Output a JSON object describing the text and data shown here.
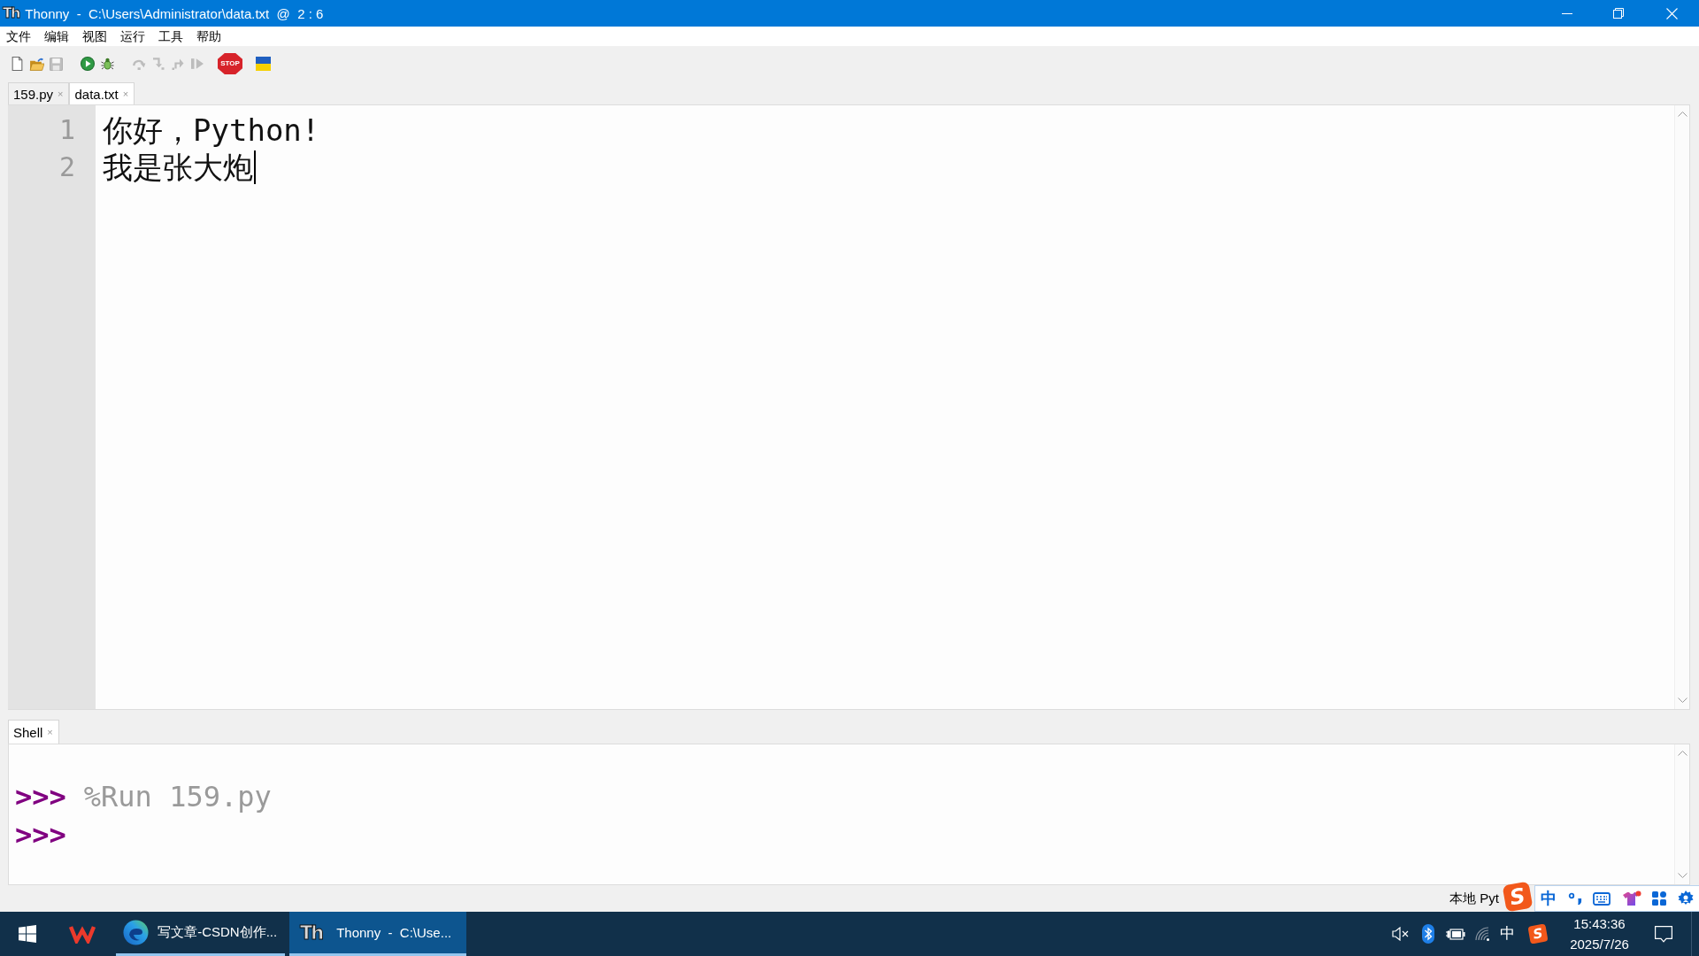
{
  "window": {
    "logo": "Th",
    "title": "Thonny  -  C:\\Users\\Administrator\\data.txt  @  2 : 6"
  },
  "menu": [
    "文件",
    "编辑",
    "视图",
    "运行",
    "工具",
    "帮助"
  ],
  "toolbar": [
    [
      {
        "kind": "new",
        "disabled": false
      },
      {
        "kind": "open",
        "disabled": false
      },
      {
        "kind": "save",
        "disabled": true
      }
    ],
    [
      {
        "kind": "run",
        "disabled": false
      },
      {
        "kind": "debug",
        "disabled": false
      }
    ],
    [
      {
        "kind": "step_over",
        "disabled": true
      },
      {
        "kind": "step_into",
        "disabled": true
      },
      {
        "kind": "step_out",
        "disabled": true
      },
      {
        "kind": "resume",
        "disabled": true
      }
    ],
    [
      {
        "kind": "stop",
        "label": "STOP",
        "disabled": false
      }
    ],
    [
      {
        "kind": "flag",
        "disabled": false
      }
    ]
  ],
  "editor_tabs": [
    {
      "label": "159.py",
      "close": "×",
      "selected": false
    },
    {
      "label": "data.txt",
      "close": "×",
      "selected": true
    }
  ],
  "editor": {
    "lines": [
      {
        "number": "1",
        "text": "你好，Python!",
        "caret": false
      },
      {
        "number": "2",
        "text": "我是张大炮",
        "caret": true
      }
    ]
  },
  "shell": {
    "tabs": [
      {
        "label": "Shell",
        "close": "×",
        "selected": true
      }
    ],
    "lines": [
      {
        "prompt": ">>>",
        "command": "%Run 159.py"
      },
      {
        "prompt": ">>>"
      }
    ]
  },
  "status_bar": {
    "text": "本地 Pyt"
  },
  "ime_toolbar": {
    "logo": "S",
    "mode": "中"
  },
  "taskbar": {
    "pinned": [
      {
        "kind": "wps"
      }
    ],
    "windows": [
      {
        "kind": "edge",
        "label": "写文章-CSDN创作...",
        "selected": false
      },
      {
        "kind": "thonny",
        "logo": "Th",
        "label": "Thonny  -  C:\\Use...",
        "selected": true
      }
    ],
    "tray": {
      "input_mode": "中",
      "ime_logo": "S",
      "time": "15:43:36",
      "date": "2025/7/26"
    }
  }
}
